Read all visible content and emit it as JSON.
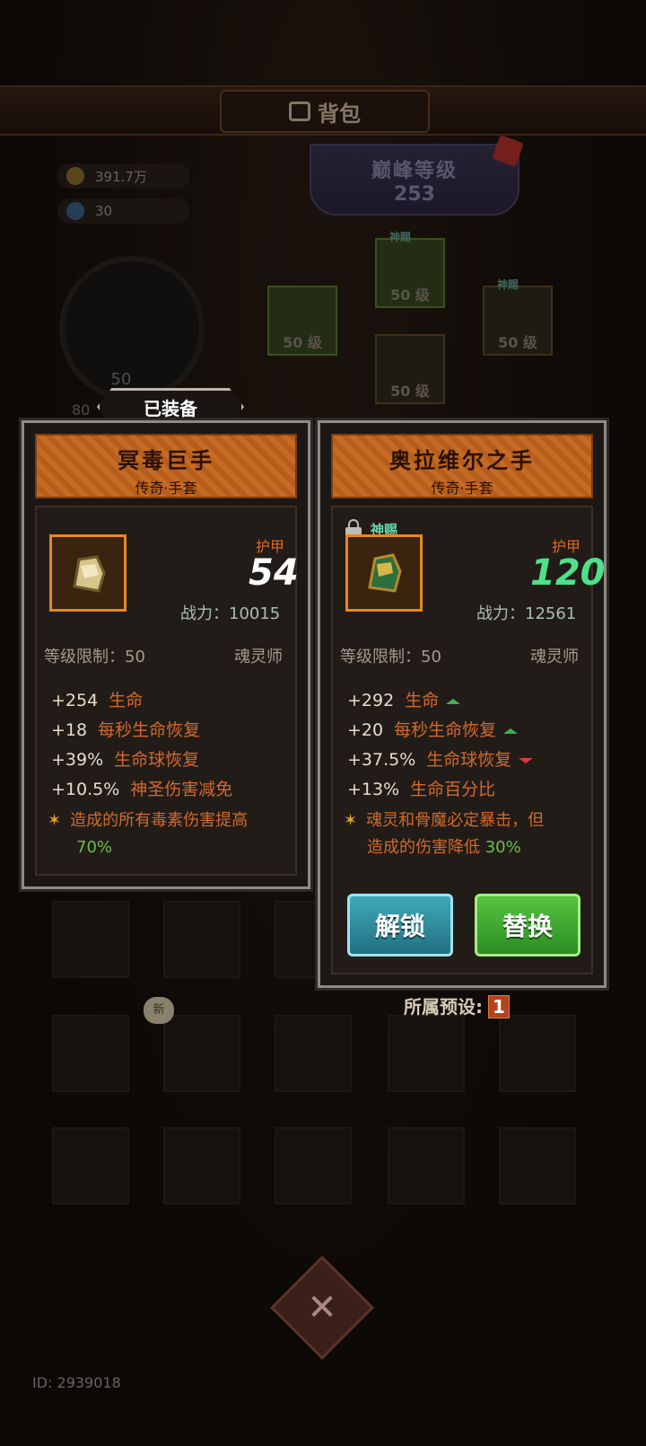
{
  "header": {
    "title": "背包"
  },
  "resources": {
    "gold": "391.7万",
    "gems": "30"
  },
  "peak_level": {
    "label": "巅峰等级",
    "value": "253"
  },
  "character": {
    "level": "50",
    "side_value": "80"
  },
  "slot_level": "50 级",
  "god_label": "神赐",
  "equipped_label": "已装备",
  "current": {
    "name": "冥毒巨手",
    "subtitle": "传奇·手套",
    "armor_label": "护甲",
    "armor": "54",
    "power": "战力：10015",
    "req": "等级限制：50",
    "class": "魂灵师",
    "stats": [
      {
        "value": "+254",
        "name": "生命"
      },
      {
        "value": "+18",
        "name": "每秒生命恢复"
      },
      {
        "value": "+39%",
        "name": "生命球恢复"
      },
      {
        "value": "+10.5%",
        "name": "神圣伤害减免"
      }
    ],
    "special_line1": "造成的所有毒素伤害提高",
    "special_line2": "70%"
  },
  "candidate": {
    "name": "奥拉维尔之手",
    "subtitle": "传奇·手套",
    "god_label": "神赐",
    "armor_label": "护甲",
    "armor": "120",
    "power": "战力：12561",
    "req": "等级限制：50",
    "class": "魂灵师",
    "stats": [
      {
        "value": "+292",
        "name": "生命",
        "trend": "up"
      },
      {
        "value": "+20",
        "name": "每秒生命恢复",
        "trend": "up"
      },
      {
        "value": "+37.5%",
        "name": "生命球恢复",
        "trend": "down"
      },
      {
        "value": "+13%",
        "name": "生命百分比",
        "trend": "none"
      }
    ],
    "special_line1": "魂灵和骨魔必定暴击，但",
    "special_line2a": "造成的伤害降低",
    "special_line2b": "30%"
  },
  "buttons": {
    "unlock": "解锁",
    "replace": "替换"
  },
  "preset": {
    "label": "所属预设:",
    "value": "1"
  },
  "new_badge": "新",
  "player_id": "ID: 2939018",
  "colors": {
    "accent_orange": "#c56b24",
    "armor_up": "#4fe08a",
    "stat_name": "#d06a2f",
    "up": "#3eb44b",
    "down": "#d63a43"
  }
}
